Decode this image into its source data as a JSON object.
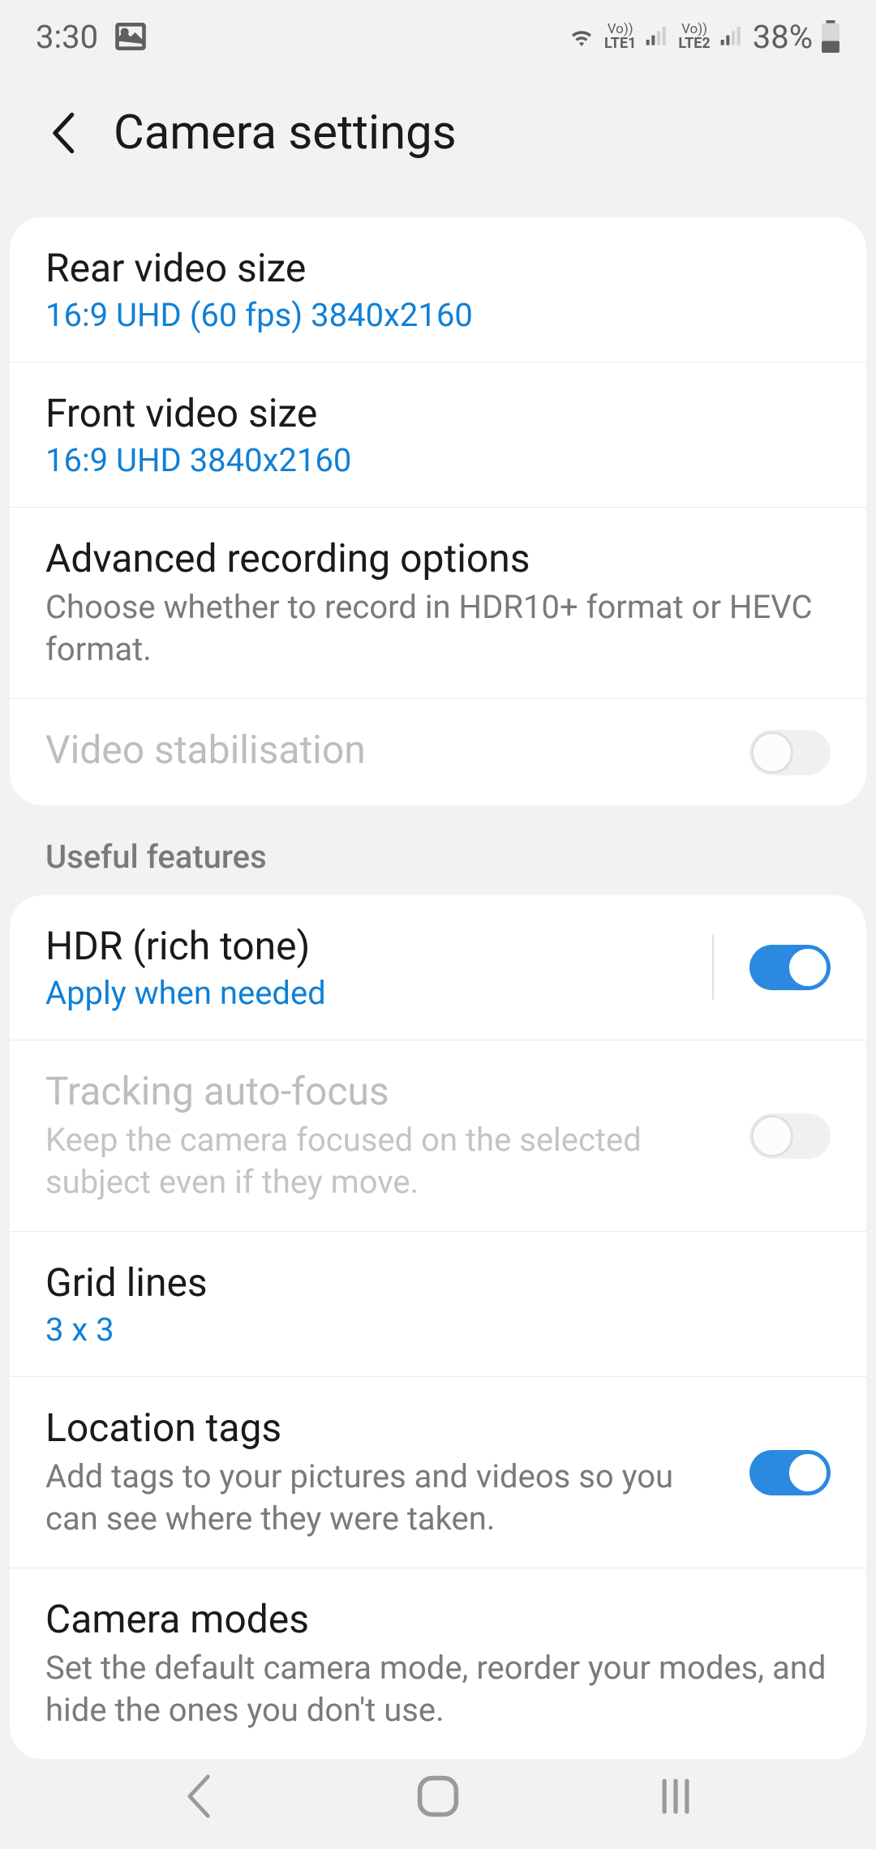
{
  "status_bar": {
    "time": "3:30",
    "battery": "38%",
    "lte1": "LTE1",
    "lte2": "LTE2",
    "vo1": "Vo))",
    "vo2": "Vo))"
  },
  "header": {
    "title": "Camera settings"
  },
  "section1": {
    "rear_video_size": {
      "title": "Rear video size",
      "value": "16:9 UHD (60 fps) 3840x2160"
    },
    "front_video_size": {
      "title": "Front video size",
      "value": "16:9 UHD 3840x2160"
    },
    "advanced_recording": {
      "title": "Advanced recording options",
      "desc": "Choose whether to record in HDR10+ format or HEVC format."
    },
    "video_stabilisation": {
      "title": "Video stabilisation"
    }
  },
  "section_label": "Useful features",
  "section2": {
    "hdr": {
      "title": "HDR (rich tone)",
      "value": "Apply when needed"
    },
    "tracking_af": {
      "title": "Tracking auto-focus",
      "desc": "Keep the camera focused on the selected subject even if they move."
    },
    "grid_lines": {
      "title": "Grid lines",
      "value": "3 x 3"
    },
    "location_tags": {
      "title": "Location tags",
      "desc": "Add tags to your pictures and videos so you can see where they were taken."
    },
    "camera_modes": {
      "title": "Camera modes",
      "desc": "Set the default camera mode, reorder your modes, and hide the ones you don't use."
    }
  }
}
